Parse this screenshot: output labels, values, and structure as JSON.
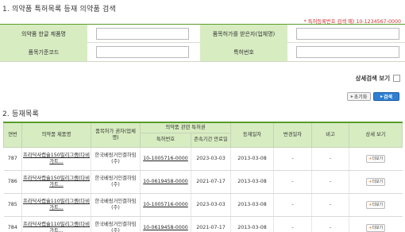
{
  "section1_title": "1. 의약품 특허목록 등재 의약품 검색",
  "patent_hint": "* 특허등록번호 검색 예) 10-1234567-0000",
  "search": {
    "drug_name_label": "의약품 한글 제품명",
    "holder_label": "품목허가를 받은자(업체명)",
    "standard_code_label": "품목기준코드",
    "patent_no_label": "특허번호",
    "drug_name_value": "",
    "holder_value": "",
    "standard_code_value": "",
    "patent_no_value": ""
  },
  "detail_search_label": "상세검색 보기",
  "buttons": {
    "reset": "초기화",
    "search": "검색"
  },
  "section2_title": "2. 등재목록",
  "table": {
    "headers": {
      "no": "연번",
      "product": "의약품 제품명",
      "holder": "품목허가 권자(업체명)",
      "patent_group": "의약품 관련 특허권",
      "patent_no": "특허번호",
      "expiry": "존속기간 만료일",
      "reg_date": "등재일자",
      "change_date": "변경일자",
      "note": "비고",
      "detail": "상세 보기"
    },
    "rows": [
      {
        "no": "787",
        "product": "프라닥사캡슐150밀리그램(다비가트...",
        "holder": "한국베링거인겔하임(주)",
        "patent_no": "10-1005716-0000",
        "expiry": "2023-03-03",
        "reg_date": "2013-03-08",
        "change_date": "-",
        "note": "-",
        "more": "더보기"
      },
      {
        "no": "786",
        "product": "프라닥사캡슐150밀리그램(다비가트...",
        "holder": "한국베링거인겔하임(주)",
        "patent_no": "10-0619458-0000",
        "expiry": "2021-07-17",
        "reg_date": "2013-03-08",
        "change_date": "-",
        "note": "-",
        "more": "더보기"
      },
      {
        "no": "785",
        "product": "프라닥사캡슐110밀리그램(다비가트...",
        "holder": "한국베링거인겔하임(주)",
        "patent_no": "10-1005716-0000",
        "expiry": "2023-03-03",
        "reg_date": "2013-03-08",
        "change_date": "-",
        "note": "-",
        "more": "더보기"
      },
      {
        "no": "784",
        "product": "프라닥사캡슐110밀리그램(다비가트...",
        "holder": "한국베링거인겔하임(주)",
        "patent_no": "10-0619458-0000",
        "expiry": "2021-07-17",
        "reg_date": "2013-03-08",
        "change_date": "-",
        "note": "-",
        "more": "더보기"
      }
    ]
  },
  "colors": {
    "header_bg": "#d7ecc1",
    "accent_green": "#5a9d2a",
    "hint_red": "#d62b2b",
    "search_blue": "#2e7fd1"
  }
}
